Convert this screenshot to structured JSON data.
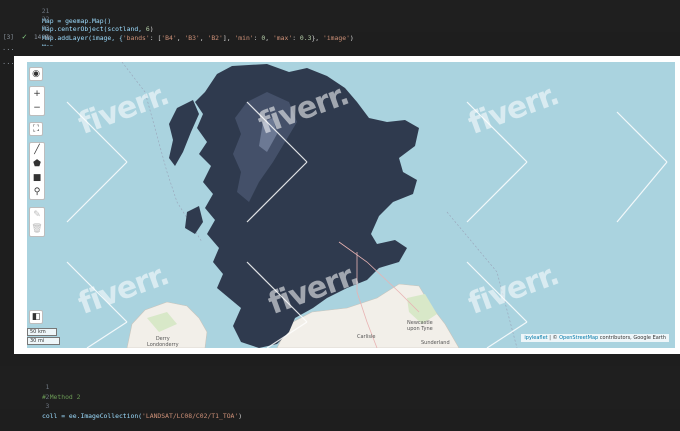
{
  "cell_top": {
    "lines": [
      {
        "num": "21",
        "text": "Map = geemap.Map()"
      },
      {
        "num": "22",
        "prefix": "Map.centerObject(scotland, ",
        "arg": "6",
        "suffix": ")"
      },
      {
        "num": "23",
        "prefix": "Map.addLayer(image, {",
        "str1": "'bands'",
        "mid1": ": [",
        "str2": "'B4'",
        "sep1": ", ",
        "str3": "'B3'",
        "sep2": ", ",
        "str4": "'B2'",
        "mid2": "], ",
        "str5": "'min'",
        "mid3": ": ",
        "n1": "0",
        "mid4": ", ",
        "str6": "'max'",
        "mid5": ": ",
        "n2": "0.3",
        "mid6": "}, ",
        "str7": "'image'",
        "suffix": ")"
      },
      {
        "num": "24",
        "text": "Map"
      }
    ],
    "exec_count": "[3]",
    "exec_time": "14.9s"
  },
  "output": {
    "ellipsis": "..."
  },
  "map": {
    "colors": {
      "sea": "#aad3df",
      "land": "#f2efe9",
      "image": "#2f3a4e"
    },
    "controls": {
      "layers_icon": "globe-icon",
      "zoom_in": "+",
      "zoom_out": "−",
      "fullscreen_icon": "fullscreen-icon",
      "draw_line_icon": "polyline-icon",
      "draw_polygon_icon": "polygon-icon",
      "draw_rect_icon": "rectangle-icon",
      "draw_marker_icon": "marker-icon",
      "edit_icon": "edit-icon",
      "delete_icon": "trash-icon",
      "toolbar_icon": "toolbar-icon"
    },
    "scale": {
      "km": "50 km",
      "mi": "30 mi"
    },
    "attribution": {
      "prefix": "ipyleaflet",
      "sep": " | © ",
      "link": "OpenStreetMap",
      "suffix": " contributors, Google Earth"
    },
    "places": {
      "derry": "Derry\nLondonderry",
      "carlisle": "Carlisle",
      "newcastle": "Newcastle\nupon Tyne",
      "sunderland": "Sunderland"
    }
  },
  "watermark": {
    "text": "fiverr."
  },
  "cell_bottom": {
    "lines": [
      {
        "num": "1",
        "comment": "# Method 2"
      },
      {
        "num": "2",
        "text": ""
      },
      {
        "num": "3",
        "prefix": "coll = ee.ImageCollection(",
        "str": "'LANDSAT/LC08/C02/T1_TOA'",
        "suffix": ")"
      }
    ]
  }
}
